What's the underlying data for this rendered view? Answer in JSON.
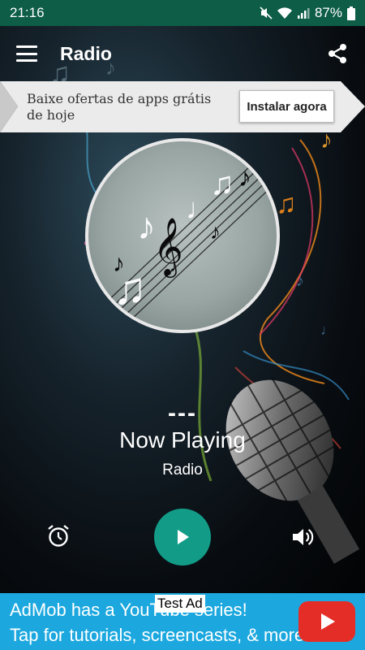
{
  "status_bar": {
    "time": "21:16",
    "battery_percent": "87%"
  },
  "app_bar": {
    "title": "Radio"
  },
  "top_ad": {
    "text": "Baixe ofertas de apps grátis de hoje",
    "button_label": "Instalar agora"
  },
  "player": {
    "track_title": "---",
    "status": "Now Playing",
    "station": "Radio",
    "playing": false
  },
  "bottom_ad": {
    "line1": "AdMob has a YouTube series!",
    "line2": "Tap for tutorials, screencasts, & more.",
    "badge": "Test Ad"
  },
  "colors": {
    "status_bar": "#0d5d47",
    "play_button": "#129c88",
    "ad_background": "#1ca8df",
    "youtube_red": "#e52d27"
  },
  "icons": [
    "mute-icon",
    "wifi-icon",
    "signal-icon",
    "battery-icon",
    "menu-icon",
    "share-icon",
    "alarm-icon",
    "play-icon",
    "volume-icon",
    "youtube-icon"
  ]
}
